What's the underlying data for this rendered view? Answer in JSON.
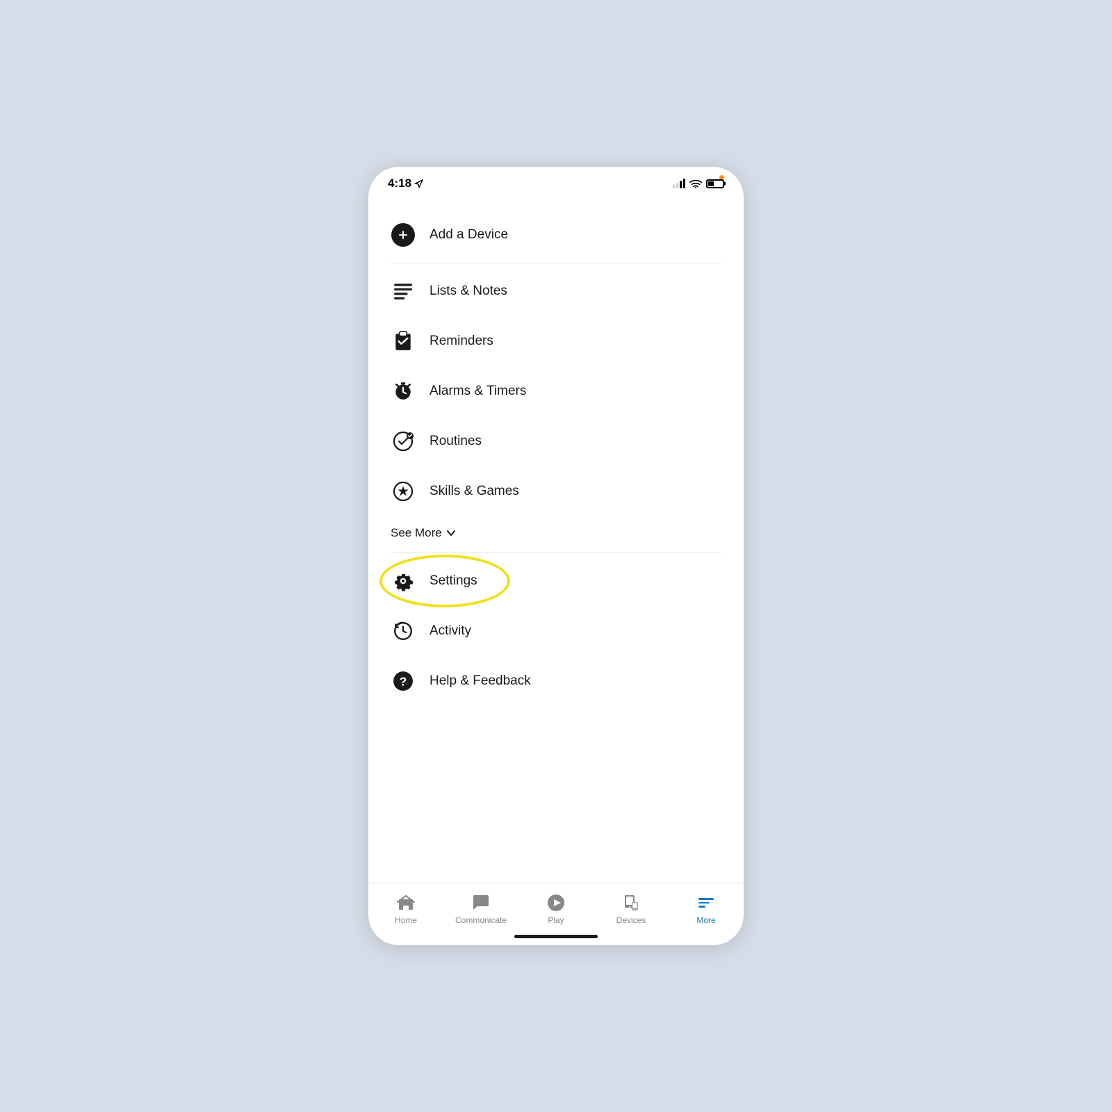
{
  "status_bar": {
    "time": "4:18",
    "navigation_arrow": "⟩"
  },
  "menu": {
    "add_device_label": "Add a Device",
    "lists_notes_label": "Lists & Notes",
    "reminders_label": "Reminders",
    "alarms_timers_label": "Alarms & Timers",
    "routines_label": "Routines",
    "skills_games_label": "Skills & Games",
    "see_more_label": "See More",
    "settings_label": "Settings",
    "activity_label": "Activity",
    "help_feedback_label": "Help & Feedback"
  },
  "bottom_nav": {
    "home_label": "Home",
    "communicate_label": "Communicate",
    "play_label": "Play",
    "devices_label": "Devices",
    "more_label": "More"
  }
}
